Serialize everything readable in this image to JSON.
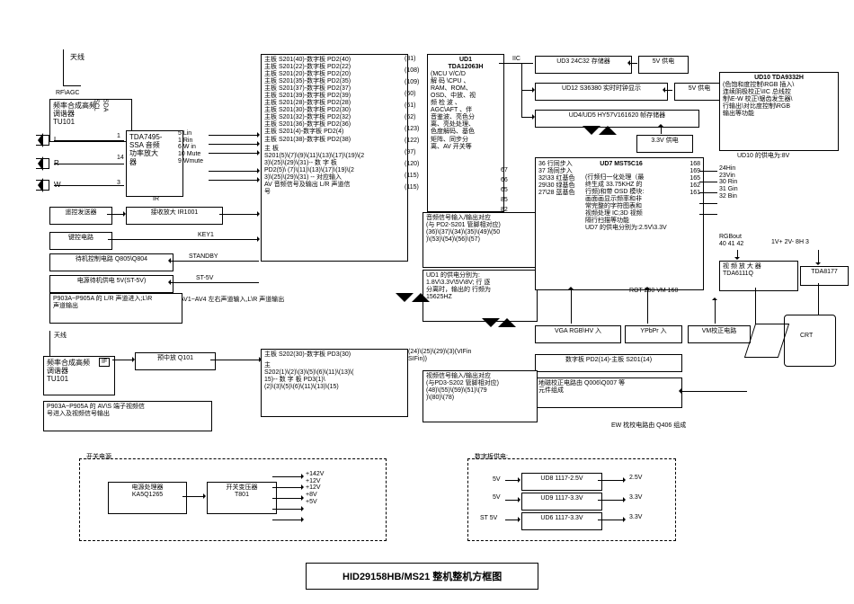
{
  "title": "HID29158HB/MS21 整机整机方框图",
  "tuner1": {
    "name": "频率合成高频\n调谐器\nTU101",
    "ant": "天线",
    "rfagc": "RF\\AGC",
    "scl": "SCL",
    "sda": "SDA"
  },
  "tda7495": {
    "name": "TDA7495-\nSSA 音频\n功率放大\n器",
    "p1": "1",
    "p14": "14",
    "p3": "3",
    "pins": "5 Lin\n1 Rin\n6 W in\n10 Mute\n9 Wmute",
    "L": "L",
    "R": "R",
    "W": "W"
  },
  "ir": {
    "label": "IR",
    "sender": "遥控发送器",
    "recv": "接收放大 IR1001",
    "key": "键控电路",
    "key1": "KEY1",
    "standby": "STANDBY",
    "ctrl": "待机控制电路 Q805\\Q804",
    "pwr": "电源待机供电 5V(ST-5V)",
    "stv": "ST-5V"
  },
  "av14": "AV1~AV4 左右声道输入,L\\R 声道输出",
  "p903a": "P903A~P905A 的 L/R 声道进入;L\\R\n声道输出",
  "tuner2": {
    "name": "频率合成高频\n调谐器\nTU101",
    "if": "IF",
    "pre": "预中放 Q101",
    "ant": "天线"
  },
  "avs": "P903A~P905A 的 AV\\S 端子视频信\n号进入及视频信号输出",
  "mainboard": {
    "l1": "主板 S201(40)-数字板 PD2(40)",
    "l2": "主板 S201(22)-数字板 PD2(22)",
    "l3": "主板 S201(20)-数字板 PD2(20)",
    "l4": "主板 S201(35)-数字板 PD2(35)",
    "l5": "主板 S201(37)-数字板 PD2(37)",
    "l6": "主板 S201(39)-数字板 PD2(39)",
    "l7": "主板 S201(28)-数字板 PD2(28)",
    "l8": "主板 S201(30)-数字板 PD2(30)",
    "l9": "主板 S201(32)-数字板 PD2(32)",
    "l10": "主板 S201(36)-数字板 PD2(36)",
    "l11": "主板 S201(4)-数字板 PD2(4)",
    "l12": "主板 S201(38)-数字板 PD2(38)",
    "sub": "主 板\nS201(5)\\(7)\\(9)\\(11)\\(13)\\(17)\\(19)\\(2\n3)\\(25)\\(29)\\(31)-- 数 字 板\nPD2(5)\\ (7)\\(11)\\(13)\\(17)\\(19)\\(2\n3)\\(25)\\(29)\\(31) -- 对应输入\nAV 音频信号及输出 L/R 声道信\n号"
  },
  "pins": {
    "p31": "(31)",
    "p108": "(108)",
    "p109": "(109)",
    "p60": "(60)",
    "p61": "(61)",
    "p62": "(62)",
    "p123": "(123)",
    "p122": "(122)",
    "p97": "(97)",
    "p120": "(120)",
    "p115a": "(115)",
    "p115b": "(115)",
    "r67": "67",
    "r66": "66",
    "r65": "65",
    "r85": "85",
    "r82": "82"
  },
  "ud1": {
    "title": "UD1\nTDA12063H",
    "body": "(MCU V/C/D\n解 码 \\CPU 、\nRAM、ROM、\nOSD、中放、视\n频 检 波 、\nAGC\\AFT 、伴\n音鉴波、亮色分\n离、亮处处理、\n色度解码、基色\n矩阵、同步分\n离、AV 开关等",
    "audio": "音频信号输入/输出对应\n(与 PD2-S201 管脚相对应)\n(36)\\(37)\\(34)\\(35)\\(49)\\(50\n)\\(53)\\(54)\\(56)\\(57)",
    "pwr": "UD1 的供电分别为:\n1.8V\\3.3V\\5V\\8V; 行 逐\n分离时，输出的 行频为\n15625HZ"
  },
  "iic": "IIC",
  "ud3": "UD3 24C32 存储器",
  "ud3v": "5V 供电",
  "ud12": "UD12 S36380 实时时钟显示",
  "ud12v": "5V 供电",
  "ud4": "UD4/UD5 HY57V161620 帧存储器",
  "ud4v": "3.3V 供电",
  "ud7": {
    "title": "UD7 MST5C16",
    "pins_l": "36 行同步入\n37 场同步入\n32\\33 红基色\n29\\30 绿基色\n27\\28 蓝基色",
    "pins_r": "168\n169\n165\n162\n161",
    "body": "(行频归一化处理（最\n终生成 33.75KHZ 的\n行频)和带 OSD 模块:\n画面画显示频率和非\n常完整的字符图表和\n视频处理 IC;3D 视频\n隔行扫描等功能\nUD7 的供电分别为:2.5V\\3.3V",
    "rot": "ROT 200 VM 160"
  },
  "ud10": {
    "title": "UD10 TDA9332H",
    "body": "(色饱和度控制\\RGB 插入\\\n连续阴极校正\\IIC 总线控\n制\\E-W 校正\\锯齿发生器\\\n行输出\\对比度控制\\RGB\n输出等功能",
    "pwr": "UD10 的供电为:8V",
    "pins": "24Hin\n23Vin\n30 Rin\n31 Gin\n32 Bin",
    "rgb": "RGBout\n40 41 42",
    "hv": "1V+ 2V- 8H 3"
  },
  "vamp": "视 频 放 大 器\nTDA6111Q",
  "tda8177": "TDA8177",
  "vga": "VGA RGB\\HV 入",
  "ypbpr": "YPbPr 入",
  "vm": "VM校正电路",
  "nb": "数字板 PD2(14)-主板 S201(14)",
  "geo": "地磁校正电路由 Q006\\Q007 等\n元件组成",
  "ew": "EW 枕校电路由 Q406 组成",
  "crt": "CRT",
  "s202": {
    "head": "主板 S202(30)-数字板 PD3(30)",
    "body": "主\nS202(1)\\(2)\\(3)\\(5)\\(6)\\(11)\\(13)\\(\n15)-- 数 字 板 PD3(1)\\\n(2)\\(3)\\(5)\\(6)\\(11)\\(13)\\(15)",
    "pins": "(24)\\(25)\\(29)\\(3)(VIFin\nSIFin))",
    "vout": "视频信号输入/输出对应\n(与PD3-S202 管脚相对应)\n(48)\\(55)\\(59)\\(51)\\(79\n)\\(80)\\(78)"
  },
  "psu": {
    "group": "开关电源",
    "proc": "电源处理器\nKA5Q1265",
    "trans": "开关变压器\nT801",
    "rails": "+142V\n+12V\n+12V\n+8V\n+5V"
  },
  "nbpsu": {
    "group": "数字板供电:",
    "in5a": "5V",
    "in5b": "5V",
    "inst": "ST 5V",
    "u8": "UD8 1117-2.5V",
    "u9": "UD9 1117-3.3V",
    "u6": "UD6 1117-3.3V",
    "out25": "2.5V",
    "out33a": "3.3V",
    "out33b": "3.3V"
  }
}
